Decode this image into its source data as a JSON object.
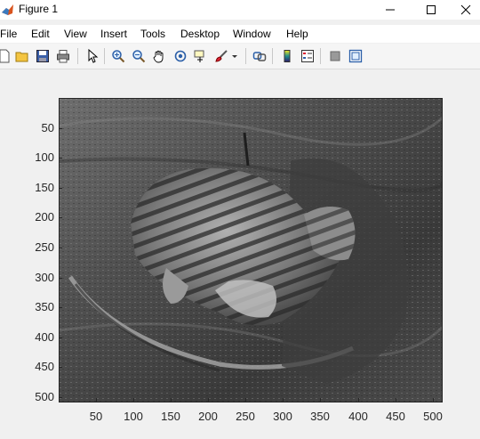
{
  "window": {
    "title": "Figure 1"
  },
  "menu": [
    "File",
    "Edit",
    "View",
    "Insert",
    "Tools",
    "Desktop",
    "Window",
    "Help"
  ],
  "toolbar": [
    "new-figure-icon",
    "open-file-icon",
    "save-icon",
    "print-icon",
    "pointer-icon",
    "zoom-in-icon",
    "zoom-out-icon",
    "pan-hand-icon",
    "rotate-3d-icon",
    "data-cursor-icon",
    "brush-icon",
    "brush-dropdown-icon",
    "link-plot-icon",
    "colorbar-icon",
    "legend-icon",
    "hide-plot-tools-icon",
    "show-plot-tools-icon"
  ],
  "axes": {
    "yticks": [
      "50",
      "100",
      "150",
      "200",
      "250",
      "300",
      "350",
      "400",
      "450",
      "500"
    ],
    "xticks": [
      "50",
      "100",
      "150",
      "200",
      "250",
      "300",
      "350",
      "400",
      "450",
      "500"
    ]
  },
  "image": {
    "description_colors": [
      "#2f2f2f",
      "#5a5a5a",
      "#8a8a8a",
      "#c8c8c8"
    ]
  }
}
